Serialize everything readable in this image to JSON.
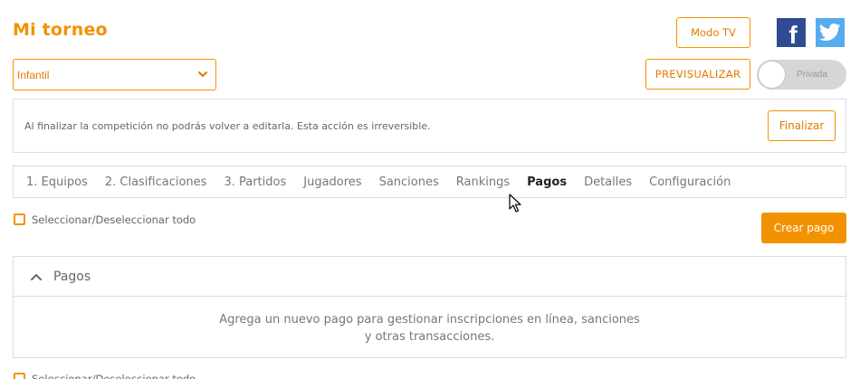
{
  "header": {
    "title": "Mi torneo",
    "modo_tv_label": "Modo TV",
    "preview_label": "PREVISUALIZAR"
  },
  "social": {
    "facebook_glyph": "f",
    "icons": [
      "facebook-icon",
      "twitter-icon"
    ]
  },
  "category_select": {
    "selected": "Infantil"
  },
  "privacy_toggle": {
    "label": "Privada",
    "on": false
  },
  "finalize": {
    "warning": "Al finalizar la competición no podrás volver a editarla. Esta acción es irreversible.",
    "button_label": "Finalizar"
  },
  "tabs": [
    {
      "label": "1. Equipos"
    },
    {
      "label": "2. Clasificaciones"
    },
    {
      "label": "3. Partidos"
    },
    {
      "label": "Jugadores"
    },
    {
      "label": "Sanciones"
    },
    {
      "label": "Rankings"
    },
    {
      "label": "Pagos",
      "active": true
    },
    {
      "label": "Detalles"
    },
    {
      "label": "Configuración"
    }
  ],
  "select_all": {
    "label": "Seleccionar/Deseleccionar todo"
  },
  "create_payment": {
    "label": "Crear pago"
  },
  "payments_panel": {
    "title": "Pagos",
    "empty_line1": "Agrega un nuevo pago para gestionar inscripciones en línea, sanciones",
    "empty_line2": "y otras transacciones."
  },
  "colors": {
    "accent": "#f39200",
    "facebook": "#2e4b93",
    "twitter": "#55acee",
    "border": "#dcdcdc"
  }
}
